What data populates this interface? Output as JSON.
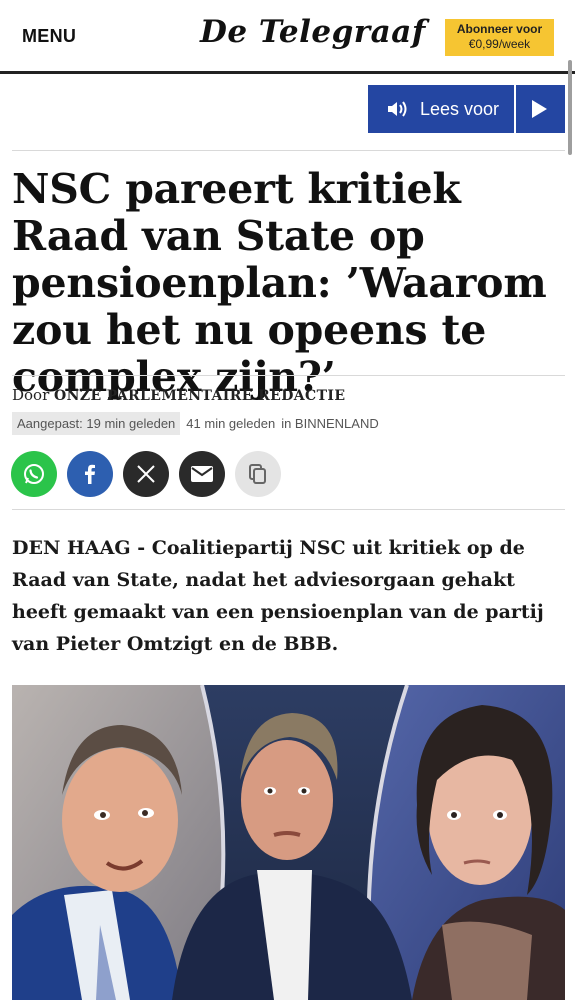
{
  "header": {
    "menu_label": "MENU",
    "logo_text": "De Telegraaf",
    "subscribe_line1": "Abonneer voor",
    "subscribe_line2": "€0,99/week",
    "subscribe_color": "#f6c532"
  },
  "audio": {
    "label": "Lees voor",
    "speaker_icon": "speaker-icon",
    "play_icon": "play-icon",
    "color": "#2446a2"
  },
  "article": {
    "headline": "NSC pareert kritiek Raad van State op pensioenplan: ’Waarom zou het nu opeens te complex zijn?’",
    "byline_prefix": "Door",
    "byline_author": "ONZE PARLEMENTAIRE REDACTIE",
    "updated": "Aangepast: 19 min geleden",
    "published": "41 min geleden",
    "category": "in BINNENLAND",
    "intro": "DEN HAAG - Coalitiepartij NSC uit kritiek op de Raad van State, nadat het adviesorgaan gehakt heeft gemaakt van een pensioenplan van de partij van Pieter Omtzigt en de BBB."
  },
  "share": {
    "buttons": [
      {
        "name": "whatsapp-icon",
        "color": "#2bc44a"
      },
      {
        "name": "facebook-icon",
        "color": "#2d5fb0"
      },
      {
        "name": "x-icon",
        "color": "#2a2a2a"
      },
      {
        "name": "email-icon",
        "color": "#2a2a2a"
      },
      {
        "name": "copy-icon",
        "color": "#e4e4e4"
      }
    ]
  }
}
